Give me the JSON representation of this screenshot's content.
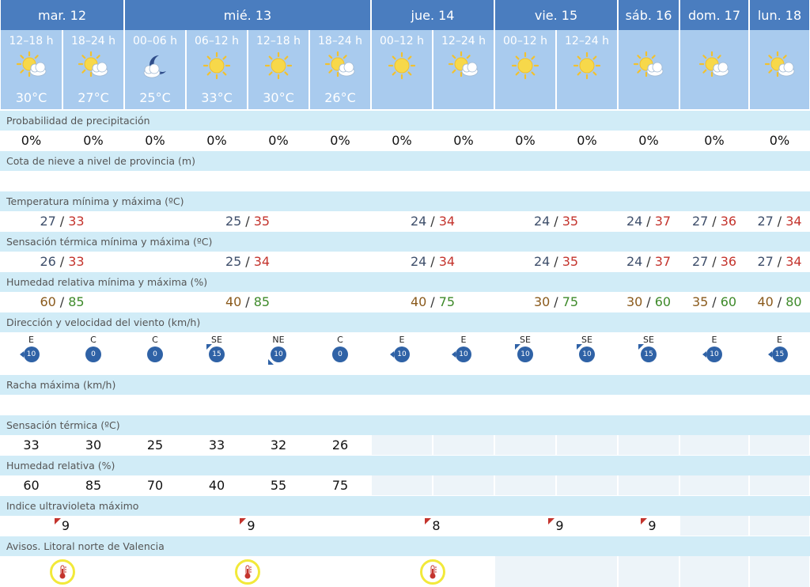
{
  "days": [
    {
      "label": "mar. 12"
    },
    {
      "label": "mié. 13"
    },
    {
      "label": "jue. 14"
    },
    {
      "label": "vie. 15"
    },
    {
      "label": "sáb. 16"
    },
    {
      "label": "dom. 17"
    },
    {
      "label": "lun. 18"
    }
  ],
  "periods": [
    {
      "label": "12–18 h",
      "icon": "sun-cloud-icon",
      "temp": "30°C"
    },
    {
      "label": "18–24 h",
      "icon": "sun-cloud-icon",
      "temp": "27°C"
    },
    {
      "label": "00–06 h",
      "icon": "moon-cloud-icon",
      "temp": "25°C"
    },
    {
      "label": "06–12 h",
      "icon": "sun-icon",
      "temp": "33°C"
    },
    {
      "label": "12–18 h",
      "icon": "sun-icon",
      "temp": "30°C"
    },
    {
      "label": "18–24 h",
      "icon": "sun-cloud-icon",
      "temp": "26°C"
    },
    {
      "label": "00–12 h",
      "icon": "sun-icon",
      "temp": ""
    },
    {
      "label": "12–24 h",
      "icon": "sun-cloud-icon",
      "temp": ""
    },
    {
      "label": "00–12 h",
      "icon": "sun-icon",
      "temp": ""
    },
    {
      "label": "12–24 h",
      "icon": "sun-icon",
      "temp": ""
    },
    {
      "label": "",
      "icon": "sun-cloud-icon",
      "temp": ""
    },
    {
      "label": "",
      "icon": "sun-cloud-icon",
      "temp": ""
    },
    {
      "label": "",
      "icon": "sun-cloud-icon",
      "temp": ""
    }
  ],
  "rows": {
    "precip": {
      "label": "Probabilidad de precipitación",
      "values": [
        "0%",
        "0%",
        "0%",
        "0%",
        "0%",
        "0%",
        "0%",
        "0%",
        "0%",
        "0%",
        "0%",
        "0%",
        "0%"
      ]
    },
    "snow": {
      "label": "Cota de nieve a nivel de provincia (m)",
      "values": [
        "",
        "",
        "",
        "",
        "",
        "",
        "",
        "",
        "",
        "",
        "",
        "",
        ""
      ]
    },
    "temp": {
      "label": "Temperatura mínima y máxima (ºC)",
      "values": [
        {
          "min": "27",
          "max": "33"
        },
        {
          "min": "25",
          "max": "35"
        },
        {
          "min": "24",
          "max": "34"
        },
        {
          "min": "24",
          "max": "35"
        },
        {
          "min": "24",
          "max": "37"
        },
        {
          "min": "27",
          "max": "36"
        },
        {
          "min": "27",
          "max": "34"
        }
      ]
    },
    "feels_mm": {
      "label": "Sensación térmica mínima y máxima (ºC)",
      "values": [
        {
          "min": "26",
          "max": "33"
        },
        {
          "min": "25",
          "max": "34"
        },
        {
          "min": "24",
          "max": "34"
        },
        {
          "min": "24",
          "max": "35"
        },
        {
          "min": "24",
          "max": "37"
        },
        {
          "min": "27",
          "max": "36"
        },
        {
          "min": "27",
          "max": "34"
        }
      ]
    },
    "hum_mm": {
      "label": "Humedad relativa mínima y máxima (%)",
      "values": [
        {
          "min": "60",
          "max": "85"
        },
        {
          "min": "40",
          "max": "85"
        },
        {
          "min": "40",
          "max": "75"
        },
        {
          "min": "30",
          "max": "75"
        },
        {
          "min": "30",
          "max": "60"
        },
        {
          "min": "35",
          "max": "60"
        },
        {
          "min": "40",
          "max": "80"
        }
      ]
    },
    "wind": {
      "label": "Dirección y velocidad del viento (km/h)",
      "values": [
        {
          "dir": "E",
          "speed": "10",
          "arrow": "w"
        },
        {
          "dir": "C",
          "speed": "0",
          "arrow": ""
        },
        {
          "dir": "C",
          "speed": "0",
          "arrow": ""
        },
        {
          "dir": "SE",
          "speed": "15",
          "arrow": "nw"
        },
        {
          "dir": "NE",
          "speed": "10",
          "arrow": "sw"
        },
        {
          "dir": "C",
          "speed": "0",
          "arrow": ""
        },
        {
          "dir": "E",
          "speed": "10",
          "arrow": "w"
        },
        {
          "dir": "E",
          "speed": "10",
          "arrow": "w"
        },
        {
          "dir": "SE",
          "speed": "10",
          "arrow": "nw"
        },
        {
          "dir": "SE",
          "speed": "10",
          "arrow": "nw"
        },
        {
          "dir": "SE",
          "speed": "15",
          "arrow": "nw"
        },
        {
          "dir": "E",
          "speed": "10",
          "arrow": "w"
        },
        {
          "dir": "E",
          "speed": "15",
          "arrow": "w"
        }
      ]
    },
    "gust": {
      "label": "Racha máxima (km/h)",
      "values": [
        "",
        "",
        "",
        "",
        "",
        "",
        "",
        "",
        "",
        "",
        "",
        "",
        ""
      ]
    },
    "feels": {
      "label": "Sensación térmica (ºC)",
      "values": [
        "33",
        "30",
        "25",
        "33",
        "32",
        "26"
      ]
    },
    "hum": {
      "label": "Humedad relativa (%)",
      "values": [
        "60",
        "85",
        "70",
        "40",
        "55",
        "75"
      ]
    },
    "uv": {
      "label": "Indice ultravioleta máximo",
      "values": [
        "9",
        "9",
        "8",
        "9",
        "9",
        "",
        ""
      ]
    },
    "warn": {
      "label": "Avisos. Litoral norte de Valencia",
      "values": [
        "thermometer-icon",
        "thermometer-icon",
        "thermometer-icon",
        "",
        "",
        "",
        ""
      ]
    }
  },
  "colors": {
    "header": "#4a7dbf",
    "period": "#a9cbee",
    "label_row": "#d1ecf7",
    "min": "#3f4f6b",
    "max": "#c4342d",
    "warning_ring": "#f2e93a"
  }
}
